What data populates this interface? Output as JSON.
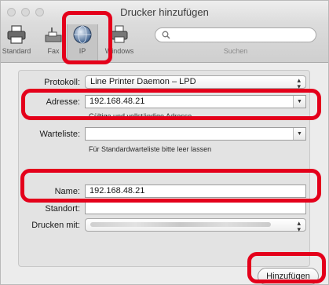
{
  "window": {
    "title": "Drucker hinzufügen"
  },
  "toolbar": {
    "buttons": [
      {
        "label": "Standard",
        "icon": "printer-icon"
      },
      {
        "label": "Fax",
        "icon": "fax-icon"
      },
      {
        "label": "IP",
        "icon": "globe-icon"
      },
      {
        "label": "Windows",
        "icon": "windows-printer-icon"
      }
    ],
    "search": {
      "label": "Suchen",
      "placeholder": "",
      "icon": "search-icon"
    }
  },
  "form": {
    "protocol": {
      "label": "Protokoll:",
      "value": "Line Printer Daemon – LPD"
    },
    "address": {
      "label": "Adresse:",
      "value": "192.168.48.21",
      "hint": "Gültige und vollständige Adresse"
    },
    "queue": {
      "label": "Warteliste:",
      "value": "",
      "hint": "Für Standardwarteliste bitte leer lassen"
    },
    "name": {
      "label": "Name:",
      "value": "192.168.48.21"
    },
    "location": {
      "label": "Standort:",
      "value": ""
    },
    "print_with": {
      "label": "Drucken mit:",
      "value": ""
    }
  },
  "add_button": {
    "label": "Hinzufügen"
  },
  "highlight_color": "#e4001b"
}
